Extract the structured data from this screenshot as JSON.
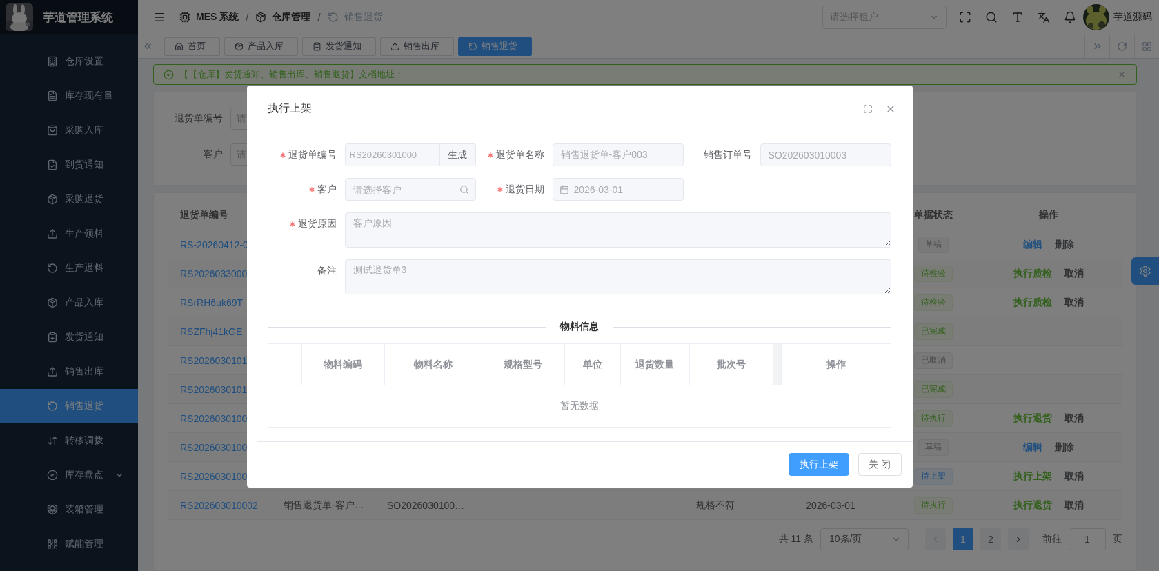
{
  "sidebar": {
    "title": "芋道管理系统",
    "items": [
      {
        "label": "仓库设置",
        "selected": false
      },
      {
        "label": "库存现有量",
        "selected": false
      },
      {
        "label": "采购入库",
        "selected": false
      },
      {
        "label": "到货通知",
        "selected": false
      },
      {
        "label": "采购退货",
        "selected": false
      },
      {
        "label": "生产领料",
        "selected": false
      },
      {
        "label": "生产退料",
        "selected": false
      },
      {
        "label": "产品入库",
        "selected": false
      },
      {
        "label": "发货通知",
        "selected": false
      },
      {
        "label": "销售出库",
        "selected": false
      },
      {
        "label": "销售退货",
        "selected": true
      },
      {
        "label": "转移调拨",
        "selected": false
      },
      {
        "label": "库存盘点",
        "selected": false,
        "expanded": false
      },
      {
        "label": "装箱管理",
        "selected": false
      },
      {
        "label": "赋能管理",
        "selected": false
      }
    ]
  },
  "navbar": {
    "breadcrumb": [
      {
        "label": "MES 系统",
        "current": false
      },
      {
        "label": "仓库管理",
        "current": false,
        "separator": "/"
      },
      {
        "label": "销售退货",
        "current": true,
        "separator": "/"
      }
    ],
    "tenant_select": {
      "placeholder": "请选择租户"
    },
    "user": {
      "name": "芋道源码"
    }
  },
  "tabs": [
    {
      "label": "首页",
      "selected": false
    },
    {
      "label": "产品入库",
      "selected": false
    },
    {
      "label": "发货通知",
      "selected": false
    },
    {
      "label": "销售出库",
      "selected": false
    },
    {
      "label": "销售退货",
      "selected": true
    }
  ],
  "alert": {
    "text": "【【仓库】发货通知、销售出库、销售退货】文档地址："
  },
  "search": {
    "fields": [
      {
        "label": "退货单编号",
        "placeholder": "请"
      },
      {
        "label": "客户",
        "placeholder": "请"
      }
    ]
  },
  "table": {
    "headers": {
      "number": "退货单编号",
      "status": "单据状态",
      "actions": "操作"
    },
    "rows": [
      {
        "number": "RS-20260412-0",
        "status": {
          "label": "草稿",
          "kind": "info"
        },
        "actions": [
          {
            "label": "编辑",
            "kind": "primary"
          },
          {
            "label": "删除",
            "kind": "plain"
          }
        ]
      },
      {
        "number": "RS2026033000",
        "status": {
          "label": "待检验",
          "kind": "success"
        },
        "actions": [
          {
            "label": "执行质检",
            "kind": "success"
          },
          {
            "label": "取消",
            "kind": "plain"
          }
        ]
      },
      {
        "number": "RSrRH6uk69T",
        "status": {
          "label": "待检验",
          "kind": "success"
        },
        "actions": [
          {
            "label": "执行质检",
            "kind": "success"
          },
          {
            "label": "取消",
            "kind": "plain"
          }
        ]
      },
      {
        "number": "RSZFhj41kGE",
        "status": {
          "label": "已完成",
          "kind": "success"
        }
      },
      {
        "number": "RS2026030101",
        "status": {
          "label": "已取消",
          "kind": "info"
        }
      },
      {
        "number": "RS2026030101",
        "status": {
          "label": "已完成",
          "kind": "success"
        }
      },
      {
        "number": "RS2026030100",
        "status": {
          "label": "待执行",
          "kind": "success"
        },
        "actions": [
          {
            "label": "执行退货",
            "kind": "success"
          },
          {
            "label": "取消",
            "kind": "plain"
          }
        ]
      },
      {
        "number": "RS2026030100",
        "status": {
          "label": "草稿",
          "kind": "info"
        },
        "actions": [
          {
            "label": "编辑",
            "kind": "primary"
          },
          {
            "label": "删除",
            "kind": "plain"
          }
        ]
      },
      {
        "number": "RS2026030100",
        "status": {
          "label": "待上架",
          "kind": "primary"
        },
        "actions": [
          {
            "label": "执行上架",
            "kind": "success"
          },
          {
            "label": "取消",
            "kind": "plain"
          }
        ]
      },
      {
        "number": "RS202603010002",
        "name": "销售退货单-客户…",
        "order": "SO2026030100…",
        "reason": "规格不符",
        "date": "2026-03-01",
        "status": {
          "label": "待执行",
          "kind": "success"
        },
        "actions": [
          {
            "label": "执行退货",
            "kind": "success"
          },
          {
            "label": "取消",
            "kind": "plain"
          }
        ]
      }
    ]
  },
  "pagination": {
    "total": "共 11 条",
    "page_size": "10条/页",
    "prev_disabled": true,
    "pages": [
      {
        "label": "1",
        "selected": true
      },
      {
        "label": "2",
        "selected": false
      }
    ],
    "goto_label": "前往",
    "goto_value": "1",
    "goto_suffix": "页"
  },
  "modal": {
    "title": "执行上架",
    "fields": [
      {
        "kind": "append",
        "label": "退货单编号",
        "required": true,
        "disabled": true,
        "value": "RS20260301000",
        "append": "生成"
      },
      {
        "kind": "text",
        "label": "退货单名称",
        "required": true,
        "disabled": true,
        "value": "销售退货单-客户003"
      },
      {
        "kind": "text",
        "label": "销售订单号",
        "required": false,
        "disabled": true,
        "value": "SO202603010003"
      },
      {
        "kind": "search",
        "label": "客户",
        "required": true,
        "disabled": true,
        "placeholder": "请选择客户"
      },
      {
        "kind": "date",
        "label": "退货日期",
        "required": true,
        "disabled": true,
        "value": "2026-03-01"
      },
      {
        "kind": "textarea",
        "label": "退货原因",
        "required": true,
        "disabled": true,
        "value": "客户原因"
      },
      {
        "kind": "textarea",
        "label": "备注",
        "required": false,
        "disabled": true,
        "value": "测试退货单3"
      }
    ],
    "section_title": "物料信息",
    "items_table": {
      "columns": [
        "物料编码",
        "物料名称",
        "规格型号",
        "单位",
        "退货数量",
        "批次号",
        "操作"
      ],
      "empty_text": "暂无数据"
    },
    "buttons": [
      {
        "label": "执行上架",
        "kind": "primary"
      },
      {
        "label": "关 闭",
        "kind": "default"
      }
    ]
  }
}
